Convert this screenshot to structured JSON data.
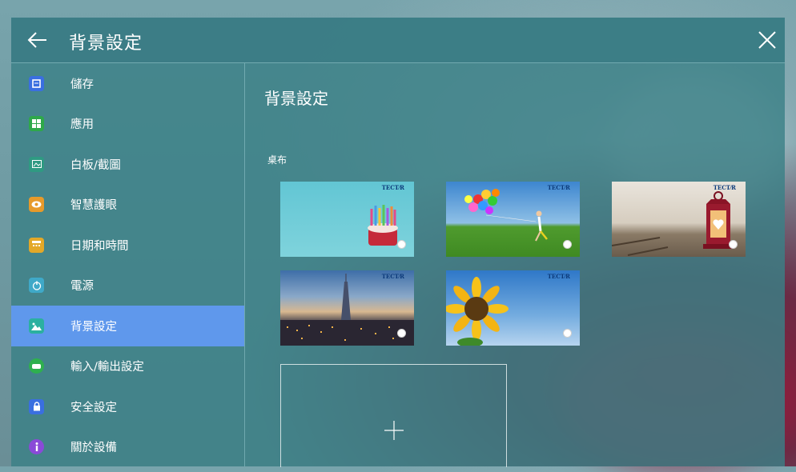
{
  "header": {
    "title": "背景設定"
  },
  "sidebar": {
    "items": [
      {
        "label": "儲存",
        "icon": "storage-icon",
        "color": "#3a6fe0"
      },
      {
        "label": "應用",
        "icon": "apps-icon",
        "color": "#2ea84a"
      },
      {
        "label": "白板/截圖",
        "icon": "whiteboard-icon",
        "color": "#2f9a82"
      },
      {
        "label": "智慧護眼",
        "icon": "eye-icon",
        "color": "#e79a2a"
      },
      {
        "label": "日期和時間",
        "icon": "calendar-icon",
        "color": "#e3a828"
      },
      {
        "label": "電源",
        "icon": "power-icon",
        "color": "#3fa9c8"
      },
      {
        "label": "背景設定",
        "icon": "wallpaper-icon",
        "color": "#2bb0a0",
        "active": true
      },
      {
        "label": "輸入/輸出設定",
        "icon": "io-icon",
        "color": "#2eb04e"
      },
      {
        "label": "安全設定",
        "icon": "lock-icon",
        "color": "#3a6fe0"
      },
      {
        "label": "關於設備",
        "icon": "info-icon",
        "color": "#8a4ad8"
      }
    ]
  },
  "main": {
    "title": "背景設定",
    "section": "桌布",
    "wallpapers": [
      {
        "name": "birthday-cake",
        "logo": "TECT⁄R"
      },
      {
        "name": "balloons-field",
        "logo": "TECT⁄R"
      },
      {
        "name": "heart-lantern",
        "logo": "TECT⁄R"
      },
      {
        "name": "taipei-skyline",
        "logo": "TECT⁄R"
      },
      {
        "name": "sunflower",
        "logo": "TECT⁄R"
      }
    ],
    "add_label": "+"
  }
}
